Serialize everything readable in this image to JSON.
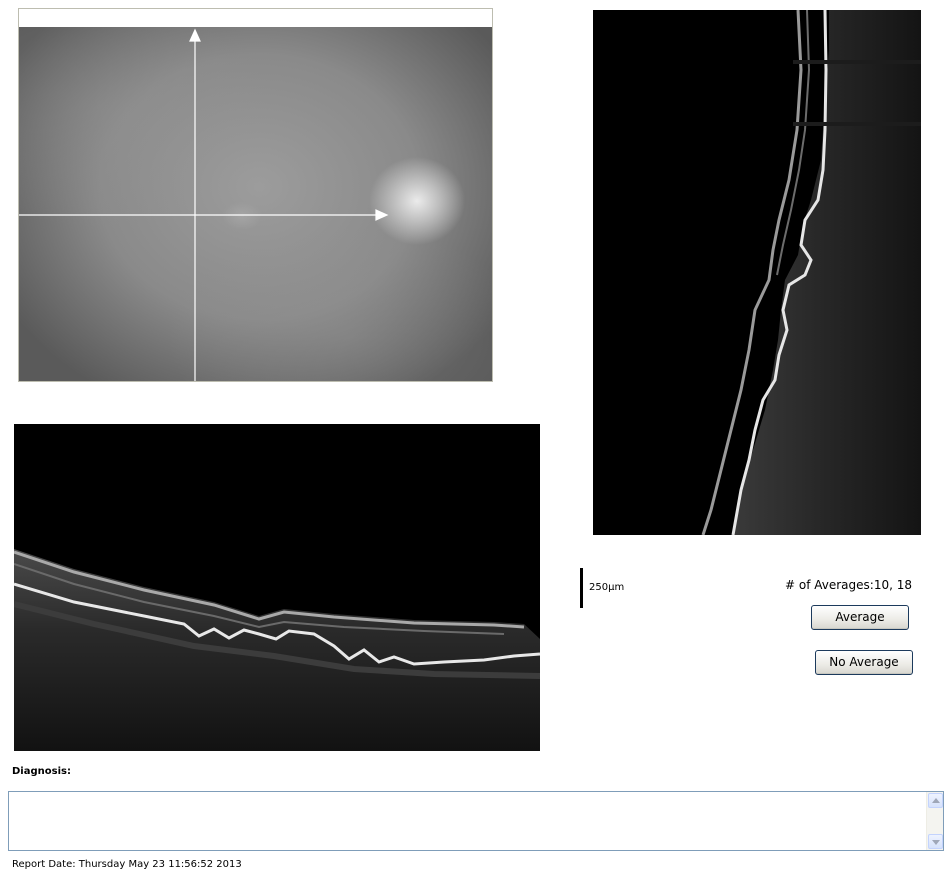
{
  "fundus": {
    "image_description": "fundus-photo",
    "scan_lines": [
      "horizontal-scan-arrow",
      "vertical-scan-arrow"
    ]
  },
  "oct": {
    "horizontal_scan": "oct-b-scan-horizontal",
    "vertical_scan": "oct-b-scan-vertical"
  },
  "scale": {
    "label": "250µm"
  },
  "averages": {
    "label": "# of Averages:10, 18"
  },
  "buttons": {
    "average": "Average",
    "no_average": "No Average"
  },
  "diagnosis": {
    "label": "Diagnosis:",
    "value": ""
  },
  "report": {
    "date_label": "Report Date: Thursday May 23 11:56:52 2013"
  },
  "colors": {
    "button_border": "#1c3a5c",
    "textarea_border": "#7f9db9",
    "scan_line": "#ffffff"
  }
}
